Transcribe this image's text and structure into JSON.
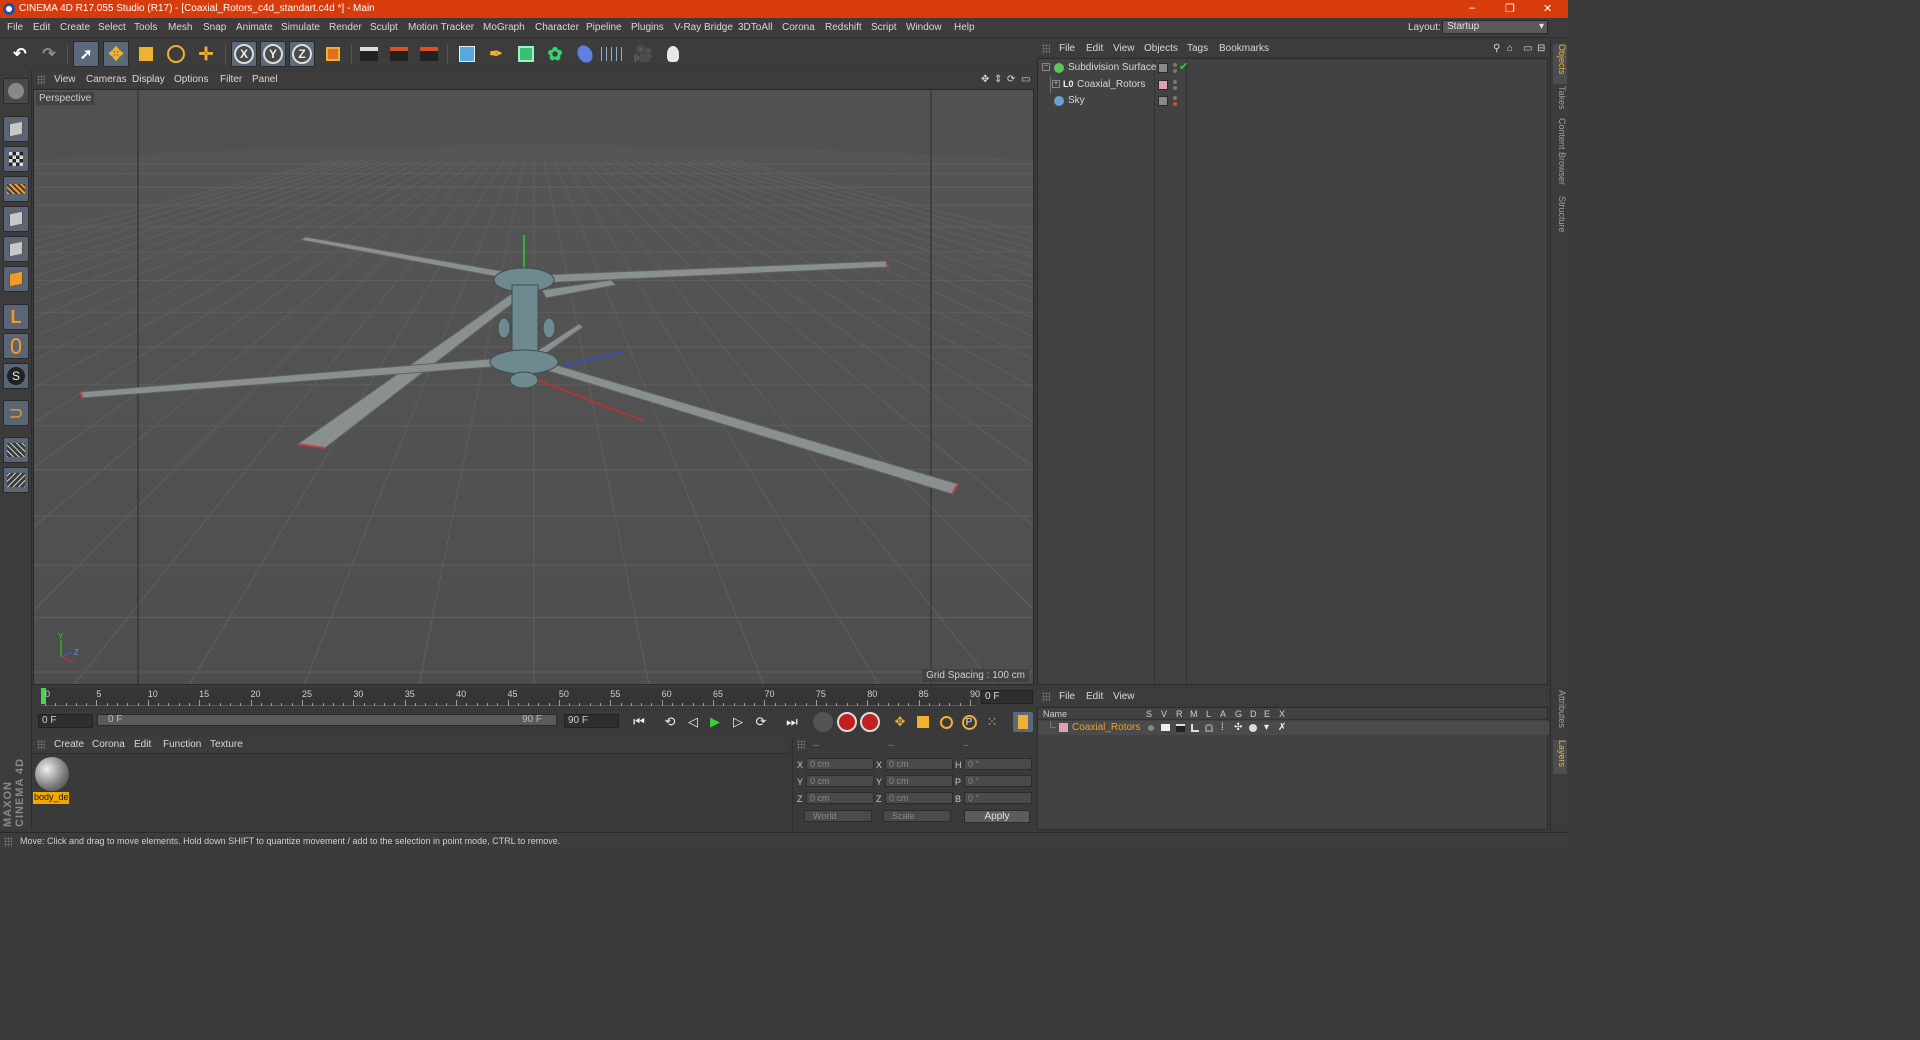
{
  "window": {
    "title": "CINEMA 4D R17.055 Studio (R17) - [Coaxial_Rotors_c4d_standart.c4d *] - Main",
    "controls": [
      "–",
      "❐",
      "✕"
    ]
  },
  "menubar": {
    "items": [
      "File",
      "Edit",
      "Create",
      "Select",
      "Tools",
      "Mesh",
      "Snap",
      "Animate",
      "Simulate",
      "Render",
      "Sculpt",
      "Motion Tracker",
      "MoGraph",
      "Character",
      "Pipeline",
      "Plugins",
      "V-Ray Bridge",
      "3DToAll",
      "Corona",
      "Redshift",
      "Script",
      "Window",
      "Help"
    ],
    "layout_label": "Layout:",
    "layout_value": "Startup"
  },
  "toolbar": {
    "axis_x": "X",
    "axis_y": "Y",
    "axis_z": "Z"
  },
  "viewport": {
    "menu": [
      "View",
      "Cameras",
      "Display",
      "Options",
      "Filter",
      "Panel"
    ],
    "camera_label": "Perspective",
    "grid_spacing": "Grid Spacing : 100 cm",
    "axis_y": "Y",
    "axis_z": "Z"
  },
  "timeline": {
    "ticks": [
      "0",
      "5",
      "10",
      "15",
      "20",
      "25",
      "30",
      "35",
      "40",
      "45",
      "50",
      "55",
      "60",
      "65",
      "70",
      "75",
      "80",
      "85",
      "90"
    ],
    "current_frame": "0 F",
    "start_field": "0 F",
    "slider_start": "0 F",
    "slider_end": "90 F",
    "end_field": "90 F"
  },
  "material_manager": {
    "menu": [
      "Create",
      "Corona",
      "Edit",
      "Function",
      "Texture"
    ],
    "materials": [
      {
        "name": "body_de"
      }
    ]
  },
  "coordinates": {
    "headers": [
      "--",
      "--",
      "--"
    ],
    "rows": [
      {
        "l1": "X",
        "v1": "0 cm",
        "l2": "X",
        "v2": "0 cm",
        "l3": "H",
        "v3": "0 °"
      },
      {
        "l1": "Y",
        "v1": "0 cm",
        "l2": "Y",
        "v2": "0 cm",
        "l3": "P",
        "v3": "0 °"
      },
      {
        "l1": "Z",
        "v1": "0 cm",
        "l2": "Z",
        "v2": "0 cm",
        "l3": "B",
        "v3": "0 °"
      }
    ],
    "mode_world": "World",
    "mode_scale": "Scale",
    "apply_label": "Apply"
  },
  "object_manager": {
    "menu": [
      "File",
      "Edit",
      "View",
      "Objects",
      "Tags",
      "Bookmarks"
    ],
    "objects": [
      {
        "name": "Subdivision Surface",
        "color": "#58c858"
      },
      {
        "name": "Coaxial_Rotors",
        "color": "#c8c8c8"
      },
      {
        "name": "Sky",
        "color": "#6aa0d8"
      }
    ]
  },
  "layer_manager": {
    "menu": [
      "File",
      "Edit",
      "View"
    ],
    "columns": [
      "Name",
      "S",
      "V",
      "R",
      "M",
      "L",
      "A",
      "G",
      "D",
      "E",
      "X"
    ],
    "layers": [
      {
        "name": "Coaxial_Rotors",
        "color": "#e0a0b0"
      }
    ]
  },
  "right_tabs": [
    "Objects",
    "Takes",
    "Content Browser",
    "Structure",
    "Attributes",
    "Layers"
  ],
  "statusbar": {
    "text": "Move: Click and drag to move elements. Hold down SHIFT to quantize movement / add to the selection in point mode, CTRL to remove."
  },
  "maxon_logo": "MAXON CINEMA 4D",
  "colors": {
    "title_bar": "#d83c0c",
    "panel_bg": "#3c3c3c",
    "viewport_bg": "#515151",
    "accent": "#f0b030",
    "material_label": "#f0a800",
    "timeline_cursor": "#4fd24f"
  }
}
